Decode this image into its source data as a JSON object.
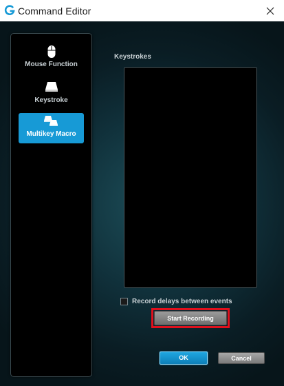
{
  "window": {
    "title": "Command Editor",
    "logo_icon": "logitech-g-icon",
    "close_icon": "close-icon",
    "accent_color": "#179ad6",
    "highlight_color": "#e0101c"
  },
  "sidebar": {
    "items": [
      {
        "label": "Mouse Function",
        "icon": "mouse-icon",
        "active": false
      },
      {
        "label": "Keystroke",
        "icon": "key-icon",
        "active": false
      },
      {
        "label": "Multikey Macro",
        "icon": "multikey-icon",
        "active": true
      }
    ]
  },
  "editor": {
    "keystrokes_title": "Keystrokes",
    "record_delays_label": "Record delays between events",
    "record_delays_checked": false,
    "start_recording_label": "Start Recording"
  },
  "footer": {
    "ok_label": "OK",
    "cancel_label": "Cancel"
  }
}
